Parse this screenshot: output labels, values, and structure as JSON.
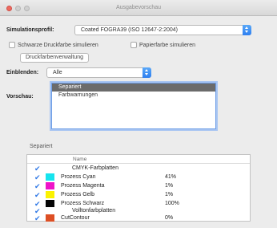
{
  "window": {
    "title": "Ausgabevorschau"
  },
  "simulation": {
    "label": "Simulationsprofil:",
    "value": "Coated FOGRA39 (ISO 12647-2:2004)"
  },
  "options": {
    "black_ink_label": "Schwarze Druckfarbe simulieren",
    "paper_color_label": "Papierfarbe simulieren",
    "ink_manager_button": "Druckfarbenverwaltung"
  },
  "show": {
    "label": "Einblenden:",
    "value": "Alle"
  },
  "preview": {
    "label": "Vorschau:",
    "items": [
      {
        "label": "Separiert",
        "selected": true
      },
      {
        "label": "Farbwarnungen",
        "selected": false
      }
    ]
  },
  "separations": {
    "group_label": "Separiert",
    "column_name": "Name",
    "rows": [
      {
        "name": "CMYK-Farbplatten",
        "value": "",
        "checked": true,
        "swatch": ""
      },
      {
        "name": "Prozess Cyan",
        "value": "41%",
        "checked": true,
        "swatch": "#16e4ee"
      },
      {
        "name": "Prozess Magenta",
        "value": "1%",
        "checked": true,
        "swatch": "#ee14c8"
      },
      {
        "name": "Prozess Gelb",
        "value": "1%",
        "checked": true,
        "swatch": "#fbf200"
      },
      {
        "name": "Prozess Schwarz",
        "value": "100%",
        "checked": true,
        "swatch": "#050505"
      },
      {
        "name": "Volltonfarbplatten",
        "value": "",
        "checked": true,
        "swatch": ""
      },
      {
        "name": "CutContour",
        "value": "0%",
        "checked": true,
        "swatch": "#dd4f24"
      }
    ]
  }
}
